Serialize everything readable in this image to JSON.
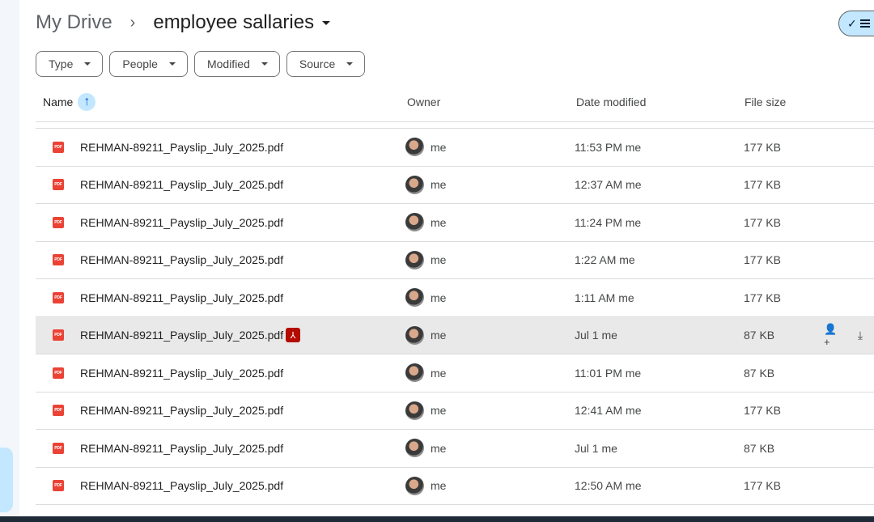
{
  "breadcrumb": {
    "root": "My Drive",
    "separator": "›",
    "current": "employee sallaries"
  },
  "filters": [
    "Type",
    "People",
    "Modified",
    "Source"
  ],
  "columns": {
    "name": "Name",
    "owner": "Owner",
    "date": "Date modified",
    "size": "File size"
  },
  "icons": {
    "pdf_badge": "PDF",
    "sort": "↑",
    "check": "✓",
    "acrobat": "⅄",
    "share": "👤+",
    "download": "⤓"
  },
  "colors": {
    "accent": "#c2e7ff",
    "pdf_red": "#ea4335",
    "selected_row": "#e9e9e9"
  },
  "files": [
    {
      "name": "REHMAN-89211_Payslip_July_2025.pdf",
      "owner": "me",
      "date": "11:53 PM me",
      "size": "177 KB"
    },
    {
      "name": "REHMAN-89211_Payslip_July_2025.pdf",
      "owner": "me",
      "date": "12:37 AM me",
      "size": "177 KB"
    },
    {
      "name": "REHMAN-89211_Payslip_July_2025.pdf",
      "owner": "me",
      "date": "11:24 PM me",
      "size": "177 KB"
    },
    {
      "name": "REHMAN-89211_Payslip_July_2025.pdf",
      "owner": "me",
      "date": "1:22 AM me",
      "size": "177 KB"
    },
    {
      "name": "REHMAN-89211_Payslip_July_2025.pdf",
      "owner": "me",
      "date": "1:11 AM me",
      "size": "177 KB"
    },
    {
      "name": "REHMAN-89211_Payslip_July_2025.pdf",
      "owner": "me",
      "date": "Jul 1 me",
      "size": "87 KB"
    },
    {
      "name": "REHMAN-89211_Payslip_July_2025.pdf",
      "owner": "me",
      "date": "11:01 PM me",
      "size": "87 KB"
    },
    {
      "name": "REHMAN-89211_Payslip_July_2025.pdf",
      "owner": "me",
      "date": "12:41 AM me",
      "size": "177 KB"
    },
    {
      "name": "REHMAN-89211_Payslip_July_2025.pdf",
      "owner": "me",
      "date": "Jul 1 me",
      "size": "87 KB"
    },
    {
      "name": "REHMAN-89211_Payslip_July_2025.pdf",
      "owner": "me",
      "date": "12:50 AM me",
      "size": "177 KB"
    }
  ]
}
